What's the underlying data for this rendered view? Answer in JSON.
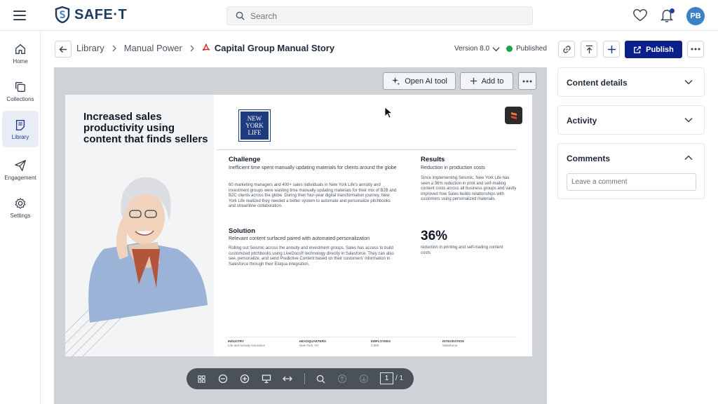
{
  "app": {
    "name": "SAFE·T"
  },
  "search": {
    "placeholder": "Search"
  },
  "user": {
    "initials": "PB"
  },
  "sidebar": {
    "items": [
      {
        "label": "Home",
        "icon": "home-icon"
      },
      {
        "label": "Collections",
        "icon": "collections-icon"
      },
      {
        "label": "Library",
        "icon": "library-icon",
        "active": true
      },
      {
        "label": "Engagement",
        "icon": "paper-plane-icon"
      },
      {
        "label": "Settings",
        "icon": "gear-icon"
      }
    ]
  },
  "breadcrumb": {
    "items": [
      "Library",
      "Manual Power"
    ],
    "current": "Capital  Group Manual Story"
  },
  "document_meta": {
    "version": "Version 8.0",
    "status": "Published",
    "status_color": "#22a34a"
  },
  "toolbar": {
    "publish_label": "Publish"
  },
  "viewer": {
    "ai_tool_label": "Open AI tool",
    "add_to_label": "Add to",
    "page_current": "1",
    "page_total": "/ 1"
  },
  "doc": {
    "headline": "Increased sales productivity using content that finds sellers",
    "logo_text": "NEW YORK LIFE",
    "challenge": {
      "title": "Challenge",
      "subtitle": "Inefficient time spent manually updating materials for clients around the globe",
      "body": "60 marketing managers and 400+ sales individuals in New York Life's annuity and investment groups were wasting time manually updating materials for their mix of B2B and B2C clients across the globe. During their four-year digital transformation journey, New York Life realized they needed a better system to automate and personalize pitchbooks and streamline collaboration."
    },
    "solution": {
      "title": "Solution",
      "subtitle": "Relevant content surfaced paired with automated personalization",
      "body": "Rolling out Seismic across the annuity and investment groups, Sales has access to build customized pitchbooks using LiveDocs® technology directly in Salesforce. They can also see, personalize, and send Predictive Content based on their customers' information in Salesforce through their Eloqua integration."
    },
    "results": {
      "title": "Results",
      "subtitle": "Reduction in production costs",
      "body": "Since implementing Seismic, New York Life has seen a 36% reduction in print and self-mailing content costs across all business groups and vastly improved how Sales builds relationships with customers using personalized materials.",
      "stat": "36%",
      "stat_caption": "reduction in printing and self-mailing content costs"
    },
    "footer": [
      {
        "label": "INDUSTRY",
        "value": "Life and Annuity Insurance"
      },
      {
        "label": "HEADQUARTERS",
        "value": "New York, NY"
      },
      {
        "label": "EMPLOYEES",
        "value": "2,500"
      },
      {
        "label": "INTEGRATION",
        "value": "Salesforce"
      }
    ]
  },
  "panels": {
    "content_details": "Content details",
    "activity": "Activity",
    "comments": "Comments",
    "comment_placeholder": "Leave a comment"
  },
  "colors": {
    "accent": "#0b1f8a",
    "avatar": "#3b82c4",
    "brand_logo": "#1e3a5f"
  }
}
